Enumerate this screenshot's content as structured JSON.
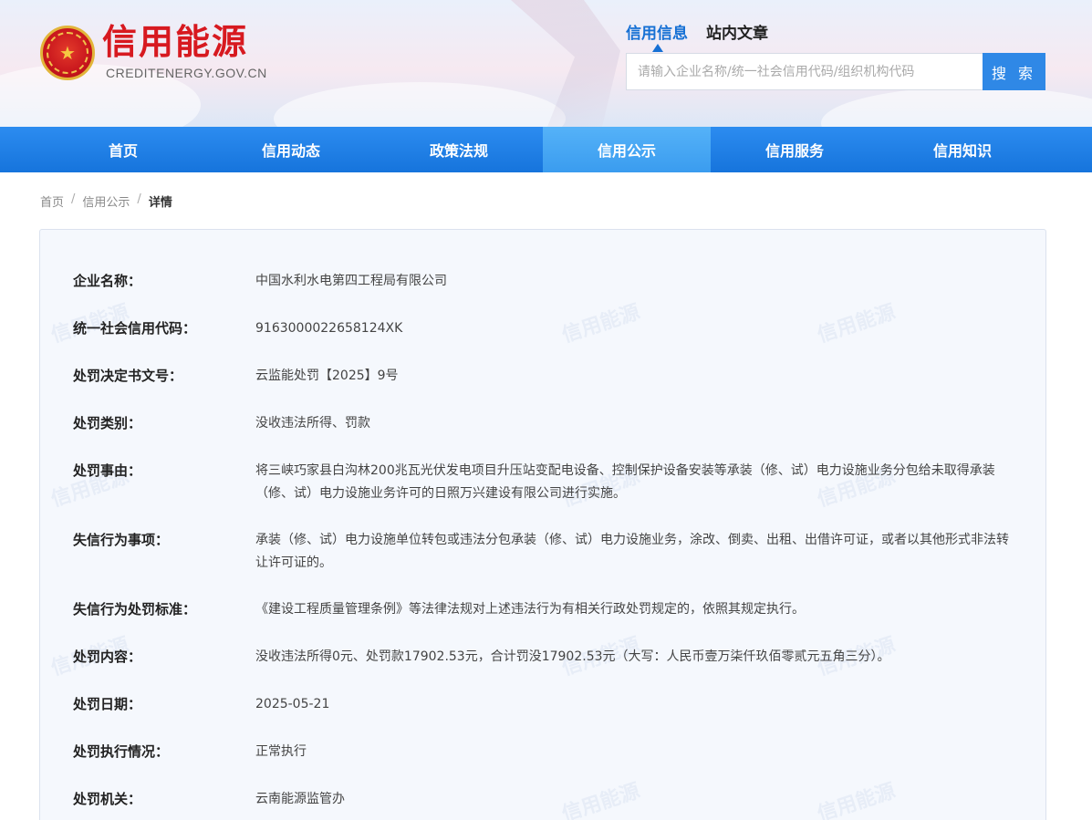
{
  "header": {
    "site_title": "信用能源",
    "site_domain": "CREDITENERGY.GOV.CN",
    "search_tabs": [
      {
        "label": "信用信息",
        "active": true
      },
      {
        "label": "站内文章",
        "active": false
      }
    ],
    "search_placeholder": "请输入企业名称/统一社会信用代码/组织机构代码",
    "search_button": "搜 索"
  },
  "nav": {
    "items": [
      {
        "label": "首页",
        "active": false
      },
      {
        "label": "信用动态",
        "active": false
      },
      {
        "label": "政策法规",
        "active": false
      },
      {
        "label": "信用公示",
        "active": true
      },
      {
        "label": "信用服务",
        "active": false
      },
      {
        "label": "信用知识",
        "active": false
      }
    ]
  },
  "breadcrumb": {
    "items": [
      "首页",
      "信用公示",
      "详情"
    ],
    "separator": "/"
  },
  "watermark_text": "信用能源",
  "detail": {
    "rows": [
      {
        "label": "企业名称：",
        "value": "中国水利水电第四工程局有限公司"
      },
      {
        "label": "统一社会信用代码：",
        "value": "9163000022658124XK"
      },
      {
        "label": "处罚决定书文号：",
        "value": "云监能处罚【2025】9号"
      },
      {
        "label": "处罚类别：",
        "value": "没收违法所得、罚款"
      },
      {
        "label": "处罚事由：",
        "value": "将三峡巧家县白沟林200兆瓦光伏发电项目升压站变配电设备、控制保护设备安装等承装（修、试）电力设施业务分包给未取得承装（修、试）电力设施业务许可的日照万兴建设有限公司进行实施。"
      },
      {
        "label": "失信行为事项：",
        "value": "承装（修、试）电力设施单位转包或违法分包承装（修、试）电力设施业务，涂改、倒卖、出租、出借许可证，或者以其他形式非法转让许可证的。"
      },
      {
        "label": "失信行为处罚标准：",
        "value": "《建设工程质量管理条例》等法律法规对上述违法行为有相关行政处罚规定的，依照其规定执行。"
      },
      {
        "label": "处罚内容：",
        "value": "没收违法所得0元、处罚款17902.53元，合计罚没17902.53元（大写：人民币壹万柒仟玖佰零贰元五角三分）。"
      },
      {
        "label": "处罚日期：",
        "value": "2025-05-21"
      },
      {
        "label": "处罚执行情况：",
        "value": "正常执行"
      },
      {
        "label": "处罚机关：",
        "value": "云南能源监管办"
      }
    ]
  }
}
